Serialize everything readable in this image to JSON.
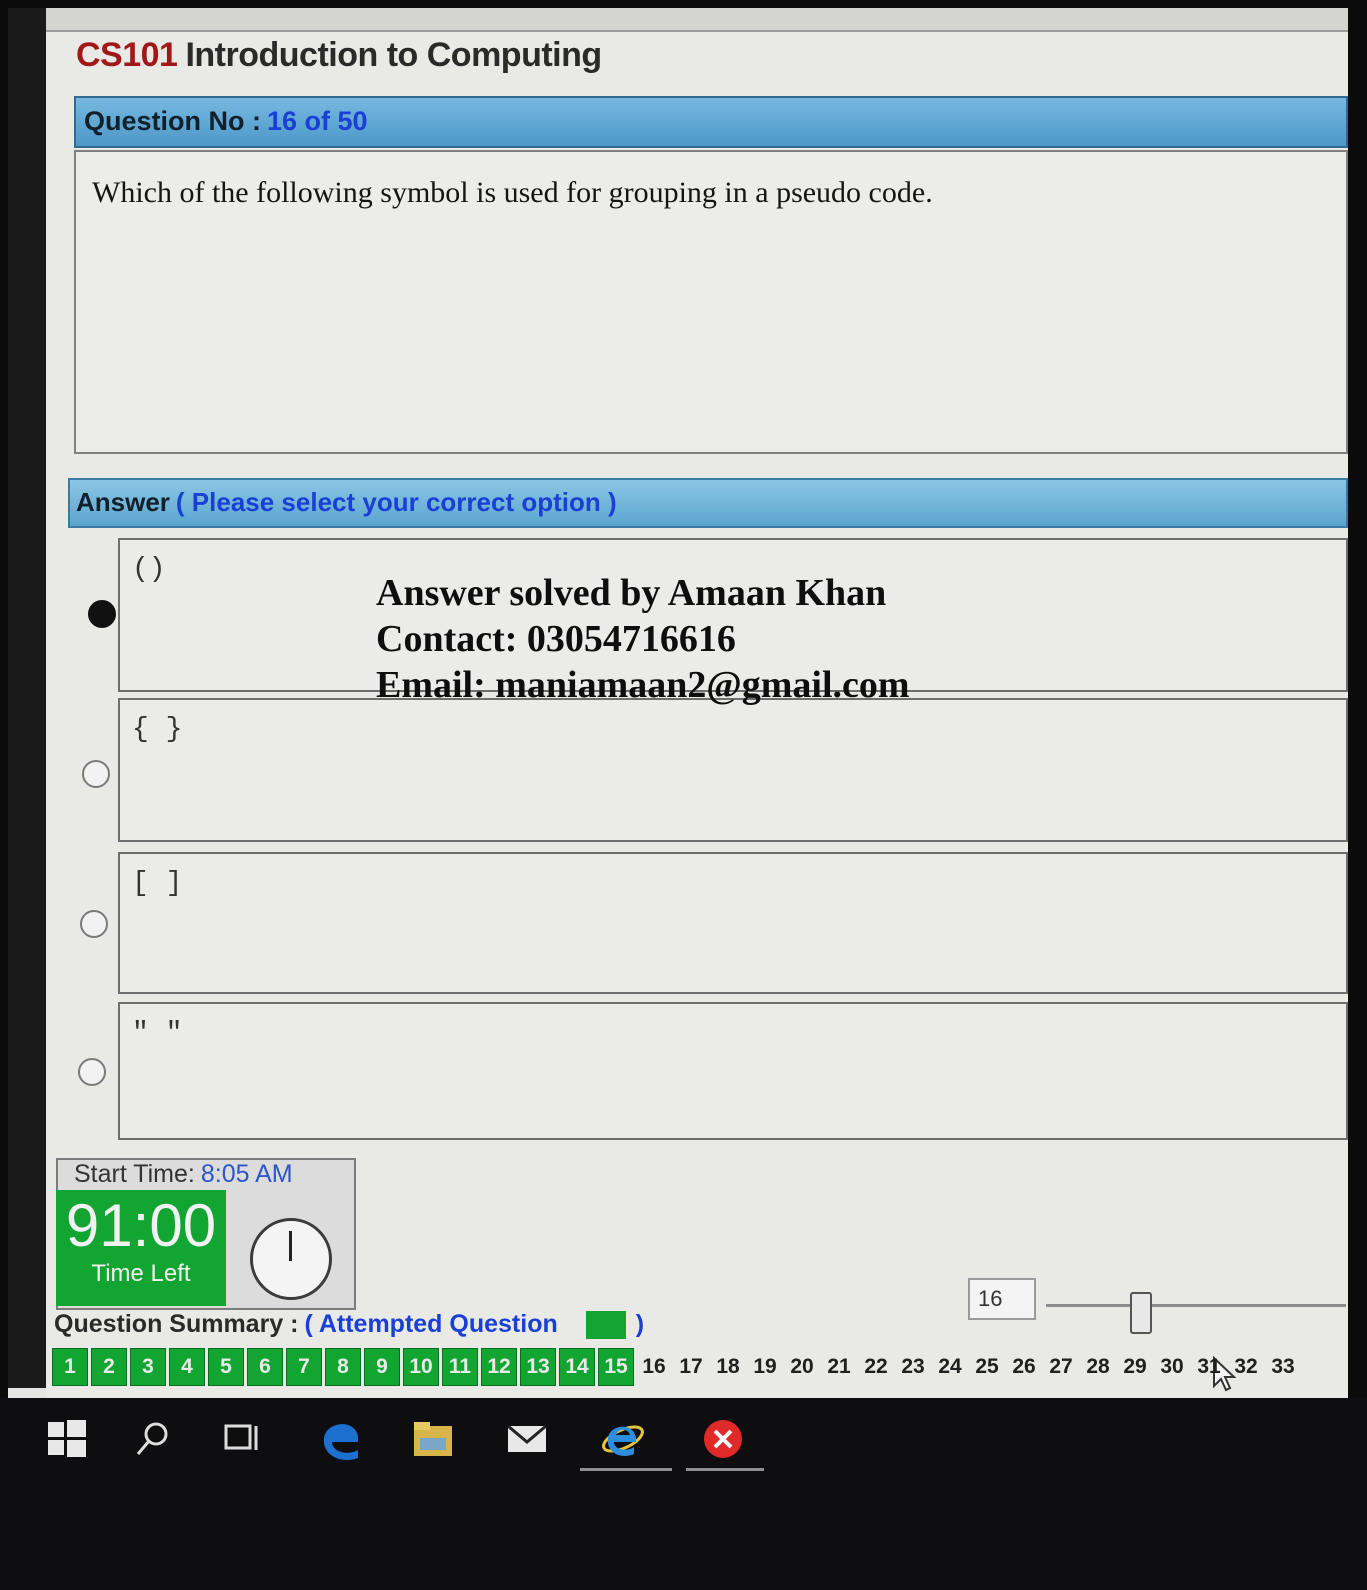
{
  "exam": {
    "course_code": "CS101",
    "course_name": "Introduction to Computing",
    "question_label": "Question No :",
    "question_number": "16 of 50",
    "question_text": "Which of the following symbol is used for grouping in a pseudo code.",
    "answer_label": "Answer",
    "answer_hint": "( Please select your correct option )",
    "options": [
      {
        "text": "()",
        "selected": true
      },
      {
        "text": "{ }",
        "selected": false
      },
      {
        "text": "[ ]",
        "selected": false
      },
      {
        "text": "\" \"",
        "selected": false
      }
    ]
  },
  "overlay": {
    "line1": "Answer solved by Amaan Khan",
    "line2": "Contact: 03054716616",
    "line3": "Email: maniamaan2@gmail.com"
  },
  "timer": {
    "start_label": "Start Time:",
    "start_value": "8:05 AM",
    "remaining": "91:00",
    "remaining_label": "Time Left"
  },
  "navigator": {
    "current_question": "16",
    "slider_position_fraction": 0.3
  },
  "summary": {
    "label": "Question Summary :",
    "hint_open": "( Attempted Question",
    "hint_close": ")",
    "attempted_color": "#12a532",
    "questions": [
      "1",
      "2",
      "3",
      "4",
      "5",
      "6",
      "7",
      "8",
      "9",
      "10",
      "11",
      "12",
      "13",
      "14",
      "15",
      "16",
      "17",
      "18",
      "19",
      "20",
      "21",
      "22",
      "23",
      "24",
      "25",
      "26",
      "27",
      "28",
      "29",
      "30",
      "31",
      "32",
      "33"
    ],
    "attempted_count": 15
  },
  "taskbar": {
    "icons": [
      "windows-start-icon",
      "search-icon",
      "task-view-icon",
      "edge-icon",
      "file-explorer-icon",
      "mail-icon",
      "internet-explorer-icon",
      "close-app-icon"
    ]
  }
}
